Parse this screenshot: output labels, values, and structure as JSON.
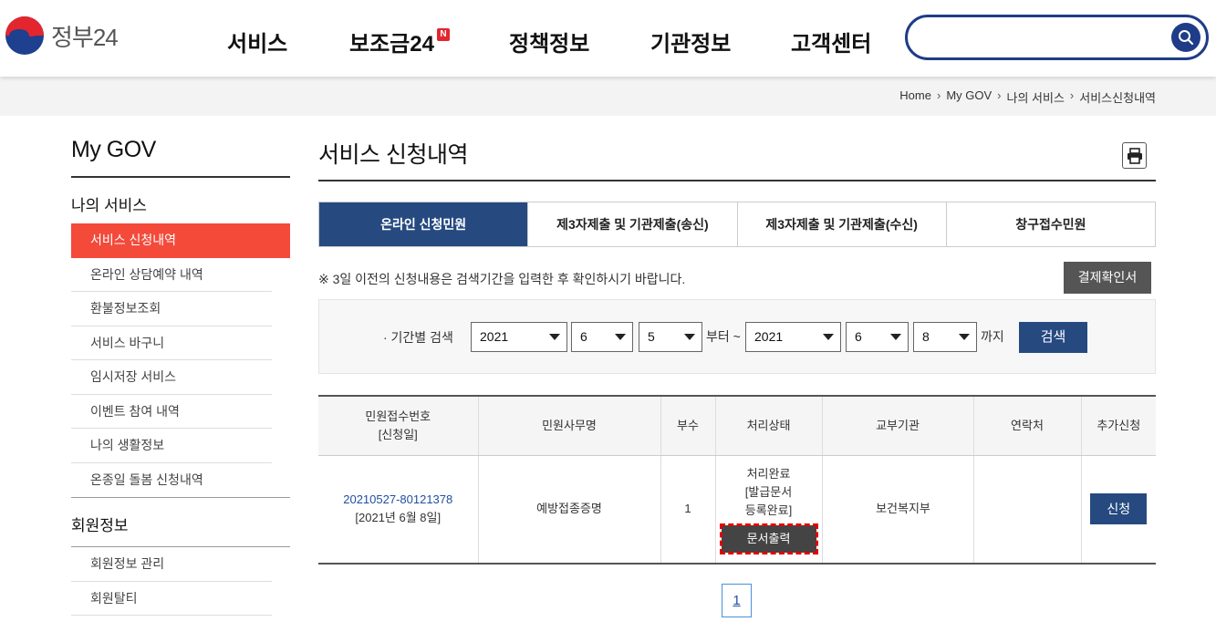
{
  "header": {
    "logo_text": "정부24",
    "nav": [
      {
        "label": "서비스"
      },
      {
        "label": "보조금24",
        "badge": "N"
      },
      {
        "label": "정책정보"
      },
      {
        "label": "기관정보"
      },
      {
        "label": "고객센터"
      }
    ],
    "search_placeholder": ""
  },
  "breadcrumb": [
    "Home",
    "My GOV",
    "나의 서비스",
    "서비스신청내역"
  ],
  "sidebar": {
    "title": "My GOV",
    "section1": "나의 서비스",
    "items": [
      "서비스 신청내역",
      "온라인 상담예약 내역",
      "환불정보조회",
      "서비스 바구니",
      "임시저장 서비스",
      "이벤트 참여 내역",
      "나의 생활정보",
      "온종일 돌봄 신청내역"
    ],
    "section2": "회원정보",
    "items2": [
      "회원정보 관리",
      "회원탈티"
    ]
  },
  "main": {
    "title": "서비스 신청내역",
    "tabs": [
      "온라인 신청민원",
      "제3자제출 및 기관제출(송신)",
      "제3자제출 및 기관제출(수신)",
      "창구접수민원"
    ],
    "notice": "※ 3일 이전의 신청내용은 검색기간을 입력한 후 확인하시기 바랍니다.",
    "confirm_button": "결제확인서",
    "filter": {
      "label": "· 기간별 검색",
      "from_year": "2021",
      "from_month": "6",
      "from_day": "5",
      "from_suffix": "부터 ~",
      "to_year": "2021",
      "to_month": "6",
      "to_day": "8",
      "to_suffix": "까지",
      "search_button": "검색"
    },
    "table": {
      "headers": [
        "민원접수번호",
        "[신청일]",
        "민원사무명",
        "부수",
        "처리상태",
        "교부기관",
        "연락처",
        "추가신청"
      ],
      "rows": [
        {
          "receipt_no": "20210527-80121378",
          "date": "[2021년 6월 8일]",
          "service": "예방접종증명",
          "copies": "1",
          "status_1": "처리완료",
          "status_2": "[발급문서",
          "status_3": "등록완료]",
          "print_button": "문서출력",
          "agency": "보건복지부",
          "contact": "",
          "apply_button": "신청"
        }
      ]
    },
    "pagination": [
      "1"
    ]
  },
  "colors": {
    "brand_navy": "#264a80",
    "active_red": "#f34a3a",
    "highlight_dashed": "#e00000"
  }
}
